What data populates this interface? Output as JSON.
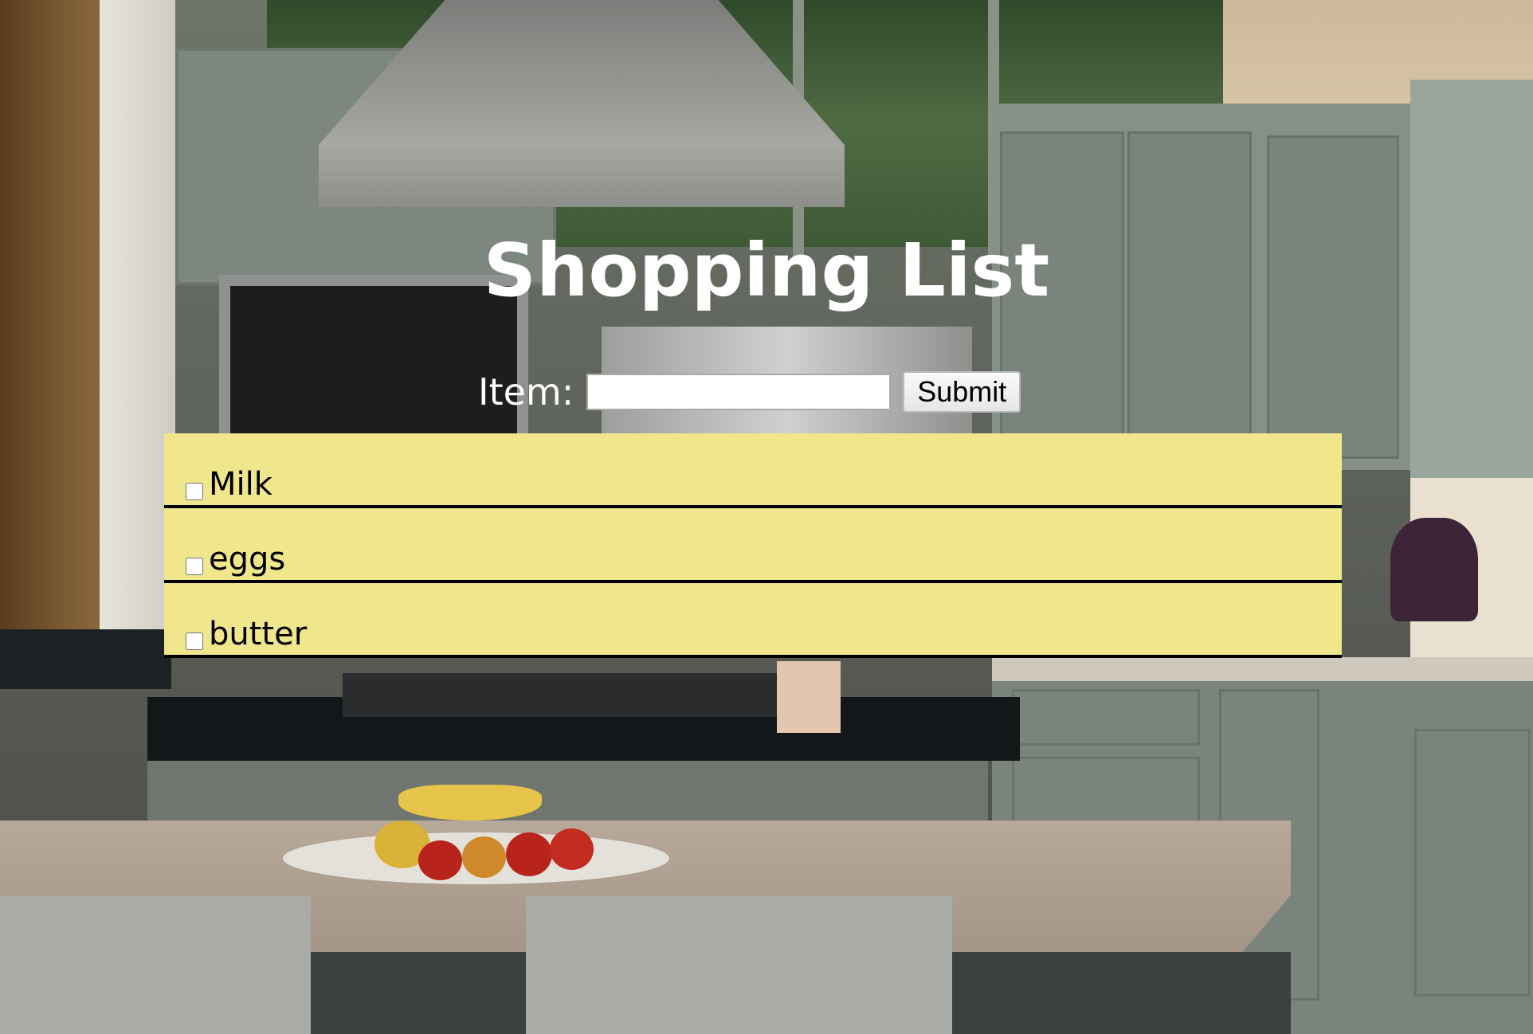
{
  "page": {
    "title": "Shopping List"
  },
  "form": {
    "label": "Item:",
    "input_value": "",
    "input_placeholder": "",
    "submit_label": "Submit"
  },
  "list": {
    "items": [
      {
        "label": "Milk",
        "checked": false
      },
      {
        "label": "eggs",
        "checked": false
      },
      {
        "label": "butter",
        "checked": false
      }
    ]
  },
  "colors": {
    "list_background": "#f0e68c",
    "divider": "#000000",
    "title": "#ffffff"
  },
  "background": {
    "icon": "kitchen-photo"
  }
}
